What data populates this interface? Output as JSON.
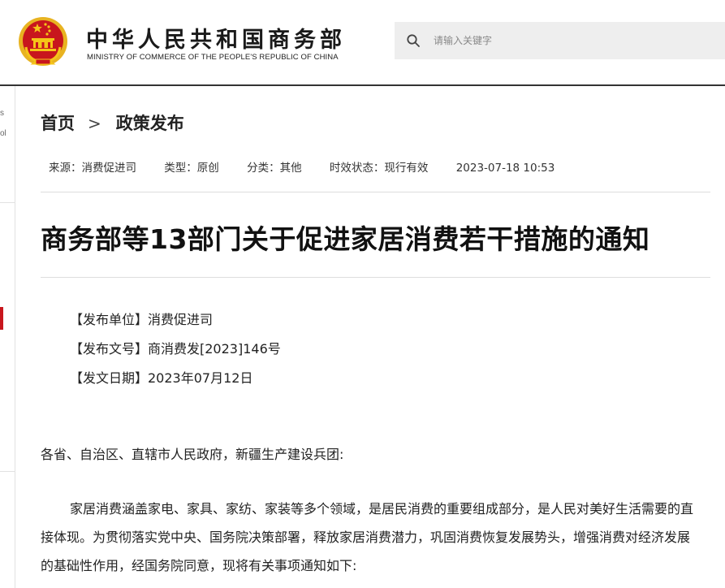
{
  "header": {
    "site_name_cn": "中华人民共和国商务部",
    "site_name_en": "MINISTRY OF COMMERCE OF THE PEOPLE'S REPUBLIC OF CHINA",
    "search_placeholder": "请输入关键字"
  },
  "rail": {
    "text1": "s",
    "text2": "ol"
  },
  "breadcrumb": {
    "home": "首页",
    "separator": ">",
    "section": "政策发布"
  },
  "meta": {
    "source": "来源：消费促进司",
    "type": "类型：原创",
    "category": "分类：其他",
    "status": "时效状态：现行有效",
    "datetime": "2023-07-18 10:53"
  },
  "article": {
    "title": "商务部等13部门关于促进家居消费若干措施的通知",
    "issuer": "【发布单位】消费促进司",
    "doc_number": "【发布文号】商消费发[2023]146号",
    "issue_date": "【发文日期】2023年07月12日",
    "salutation": "各省、自治区、直辖市人民政府，新疆生产建设兵团:",
    "paragraph1": "家居消费涵盖家电、家具、家纺、家装等多个领域，是居民消费的重要组成部分，是人民对美好生活需要的直接体现。为贯彻落实党中央、国务院决策部署，释放家居消费潜力，巩固消费恢复发展势头，增强消费对经济发展的基础性作用，经国务院同意，现将有关事项通知如下:"
  },
  "colors": {
    "accent": "#c8161d",
    "emblem_gold": "#e8b321",
    "search_bg": "#eeeeee"
  },
  "icons": {
    "emblem": "national-emblem-icon",
    "search": "search-icon"
  }
}
